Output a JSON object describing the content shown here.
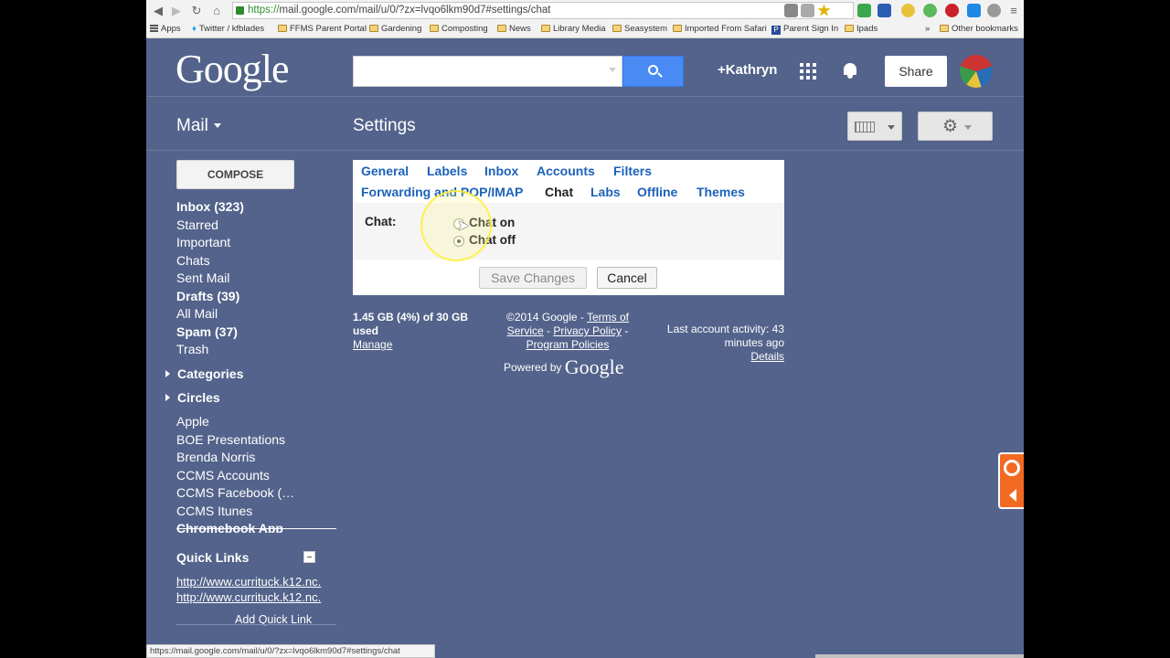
{
  "browser": {
    "url_scheme": "https://",
    "url_rest": "mail.google.com/mail/u/0/?zx=lvqo6lkm90d7#settings/chat",
    "bookmarks": [
      "Apps",
      "Twitter / kfblades",
      "FFMS Parent Portal",
      "Gardening",
      "Composting",
      "News",
      "Library Media",
      "Seasystem",
      "Imported From Safari",
      "Parent Sign In",
      "Ipads",
      "»",
      "Other bookmarks"
    ],
    "status_url": "https://mail.google.com/mail/u/0/?zx=lvqo6lkm90d7#settings/chat"
  },
  "header": {
    "logo": "Google",
    "user": "+Kathryn",
    "share_label": "Share"
  },
  "toolbar": {
    "mail_label": "Mail",
    "page_title": "Settings"
  },
  "sidebar": {
    "compose_label": "COMPOSE",
    "items": [
      {
        "label": "Inbox (323)",
        "bold": true
      },
      {
        "label": "Starred",
        "bold": false
      },
      {
        "label": "Important",
        "bold": false
      },
      {
        "label": "Chats",
        "bold": false
      },
      {
        "label": "Sent Mail",
        "bold": false
      },
      {
        "label": "Drafts (39)",
        "bold": true
      },
      {
        "label": "All Mail",
        "bold": false
      },
      {
        "label": "Spam (37)",
        "bold": true
      },
      {
        "label": "Trash",
        "bold": false
      }
    ],
    "sections": [
      "Categories",
      "Circles"
    ],
    "labels": [
      "Apple",
      "BOE Presentations",
      "Brenda Norris",
      "CCMS Accounts",
      "CCMS Facebook (…",
      "CCMS Itunes",
      "Chromebook App"
    ],
    "quick_links_title": "Quick Links",
    "quick_links": [
      "http://www.currituck.k12.nc.",
      "http://www.currituck.k12.nc."
    ],
    "add_quick_link": "Add Quick Link"
  },
  "settings": {
    "tabs_row1": [
      "General",
      "Labels",
      "Inbox",
      "Accounts",
      "Filters"
    ],
    "tabs_row2": [
      "Forwarding and POP/IMAP",
      "Chat",
      "Labs",
      "Offline",
      "Themes"
    ],
    "active_tab": "Chat",
    "chat_label": "Chat:",
    "options": [
      {
        "label": "Chat on",
        "selected": false
      },
      {
        "label": "Chat off",
        "selected": true
      }
    ],
    "save_label": "Save Changes",
    "cancel_label": "Cancel"
  },
  "footer": {
    "storage_line1": "1.45 GB (4%) of 30 GB",
    "storage_line2": "used",
    "manage": "Manage",
    "copyright": "©2014 Google - ",
    "terms": "Terms of Service",
    "privacy": "Privacy Policy",
    "program": "Program Policies",
    "powered_by": "Powered by",
    "powered_logo": "Google",
    "activity": "Last account activity: 43 minutes ago",
    "details": "Details"
  }
}
